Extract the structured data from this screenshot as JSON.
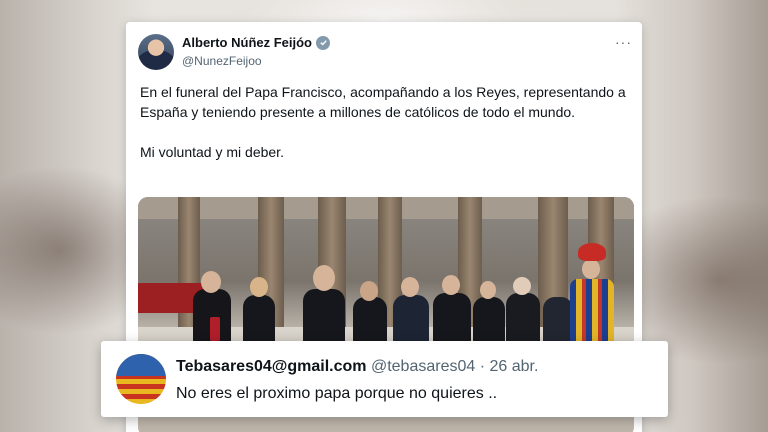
{
  "tweet": {
    "author_name": "Alberto Núñez Feijóo",
    "author_handle": "@NunezFeijoo",
    "more_label": "···",
    "text_paragraph_1": "En el funeral del Papa Francisco, acompañando a los Reyes, representando a España y teniendo presente a millones de católicos de todo el mundo.",
    "text_paragraph_2": "Mi voluntad y mi deber.",
    "verified_icon": "verified-badge-icon",
    "badge_color": "#829aab"
  },
  "reply": {
    "email": "Tebasares04@gmail.com",
    "handle": "@tebasares04",
    "separator": "·",
    "date": "26 abr.",
    "text": "No eres el proximo papa porque no quieres .."
  }
}
